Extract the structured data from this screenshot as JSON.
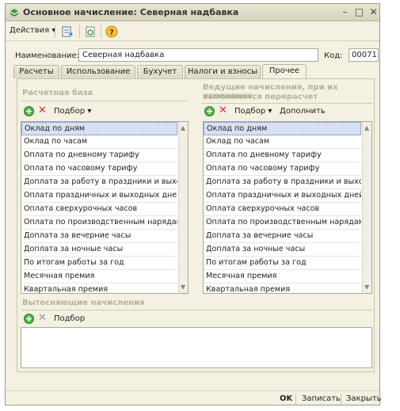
{
  "window": {
    "title": "Основное начисление: Северная надбавка"
  },
  "toolbar": {
    "actions_label": "Действия"
  },
  "form": {
    "name_label": "Наименование:",
    "name_value": "Северная надбавка",
    "code_label": "Код:",
    "code_value": "00071"
  },
  "tabs": [
    {
      "label": "Расчеты",
      "active": false
    },
    {
      "label": "Использование",
      "active": false
    },
    {
      "label": "Бухучет",
      "active": false
    },
    {
      "label": "Налоги и взносы",
      "active": false
    },
    {
      "label": "Прочее",
      "active": true
    }
  ],
  "base": {
    "title": "Расчетная база",
    "select_label": "Подбор",
    "items": [
      "Оклад по дням",
      "Оклад по часам",
      "Оплата по дневному тарифу",
      "Оплата по часовому тарифу",
      "Доплата за работу в праздники и выход...",
      "Оплата праздничных и выходных дней",
      "Оплата сверхурочных часов",
      "Оплата по производственным нарядам",
      "Доплата за вечерние часы",
      "Доплата за ночные часы",
      "По итогам работы за год",
      "Месячная премия",
      "Квартальная премия"
    ]
  },
  "leading": {
    "title_line1": "Ведущие начисления, при их изменении",
    "title_line2": "выполняется перерасчет",
    "select_label": "Подбор",
    "add_label": "Дополнить",
    "items": [
      "Оклад по дням",
      "Оклад по часам",
      "Оплата по дневному тарифу",
      "Оплата по часовому тарифу",
      "Доплата за работу в праздники и выходн...",
      "Оплата праздничных и выходных дней",
      "Оплата сверхурочных часов",
      "Оплата по производственным нарядам",
      "Доплата за вечерние часы",
      "Доплата за ночные часы",
      "По итогам работы за год",
      "Месячная премия",
      "Квартальная премия"
    ]
  },
  "displacing": {
    "title": "Вытесняющие начисления",
    "select_label": "Подбор"
  },
  "footer": {
    "ok_label": "OK",
    "save_label": "Записать",
    "close_label": "Закрыть"
  }
}
